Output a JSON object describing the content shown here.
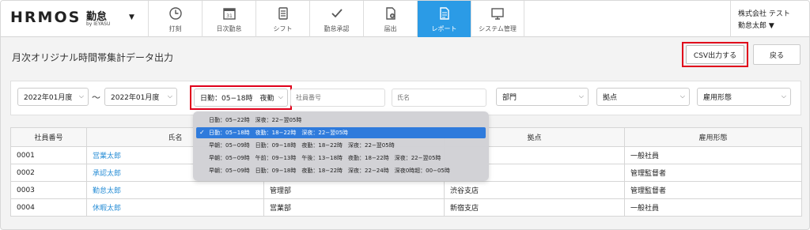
{
  "header": {
    "logo_main": "HRMOS",
    "logo_sub": "勤怠",
    "logo_by": "by IEYASU",
    "nav": [
      {
        "label": "打刻",
        "icon": "clock-icon",
        "active": false
      },
      {
        "label": "日次勤怠",
        "icon": "calendar-icon",
        "active": false
      },
      {
        "label": "シフト",
        "icon": "shift-icon",
        "active": false
      },
      {
        "label": "勤怠承認",
        "icon": "checkmark-icon",
        "active": false
      },
      {
        "label": "届出",
        "icon": "document-add-icon",
        "active": false
      },
      {
        "label": "レポート",
        "icon": "report-icon",
        "active": true
      },
      {
        "label": "システム管理",
        "icon": "monitor-icon",
        "active": false
      }
    ],
    "company": "株式会社 テスト",
    "user": "勤怠太郎 ▼"
  },
  "page": {
    "title": "月次オリジナル時間帯集計データ出力",
    "csv_button": "CSV出力する",
    "back_button": "戻る"
  },
  "filters": {
    "month_from": "2022年01月度",
    "tilde": "〜",
    "month_to": "2022年01月度",
    "time_band": "日勤：05−18時　夜勤",
    "employee_no_placeholder": "社員番号",
    "name_placeholder": "氏名",
    "department": "部門",
    "location": "拠点",
    "employment_type": "雇用形態"
  },
  "time_band_options": [
    {
      "label": "日勤：05−22時　深夜：22−翌05時",
      "selected": false
    },
    {
      "label": "日勤：05−18時　夜勤：18−22時　深夜：22−翌05時",
      "selected": true
    },
    {
      "label": "早朝：05−09時　日勤：09−18時　夜勤：18−22時　深夜：22−翌05時",
      "selected": false
    },
    {
      "label": "早朝：05−09時　午前：09−13時　午後：13−18時　夜勤：18−22時　深夜：22−翌05時",
      "selected": false
    },
    {
      "label": "早朝：05−09時　日勤：09−18時　夜勤：18−22時　深夜：22−24時　深夜0時超：00−05時",
      "selected": false
    }
  ],
  "table": {
    "columns": [
      "社員番号",
      "氏名",
      "",
      "拠点",
      "雇用形態"
    ],
    "rows": [
      {
        "no": "0001",
        "name": "営業太郎",
        "dept": "",
        "loc": "",
        "type": "一般社員"
      },
      {
        "no": "0002",
        "name": "承認太郎",
        "dept": "",
        "loc": "",
        "type": "管理監督者"
      },
      {
        "no": "0003",
        "name": "勤怠太郎",
        "dept": "管理部",
        "loc": "渋谷支店",
        "type": "管理監督者"
      },
      {
        "no": "0004",
        "name": "休暇太郎",
        "dept": "営業部",
        "loc": "新宿支店",
        "type": "一般社員"
      }
    ]
  },
  "colors": {
    "accent": "#2b9be6",
    "link": "#2b8fd6",
    "highlight": "#e0001b",
    "selected_option": "#2f7bdc"
  }
}
